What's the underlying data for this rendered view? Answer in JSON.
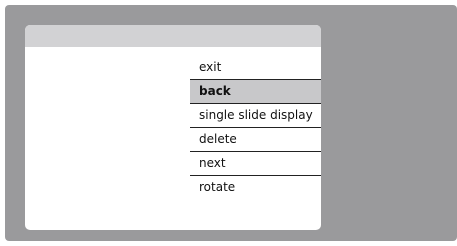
{
  "menu": {
    "items": [
      {
        "label": "exit"
      },
      {
        "label": "back"
      },
      {
        "label": "single slide display"
      },
      {
        "label": "delete"
      },
      {
        "label": "next"
      },
      {
        "label": "rotate"
      }
    ],
    "selected_index": 1
  },
  "colors": {
    "outer_background": "#9a9a9c",
    "dialog_background": "#ffffff",
    "header_background": "#d2d2d4",
    "selected_background": "#c8c8ca"
  }
}
